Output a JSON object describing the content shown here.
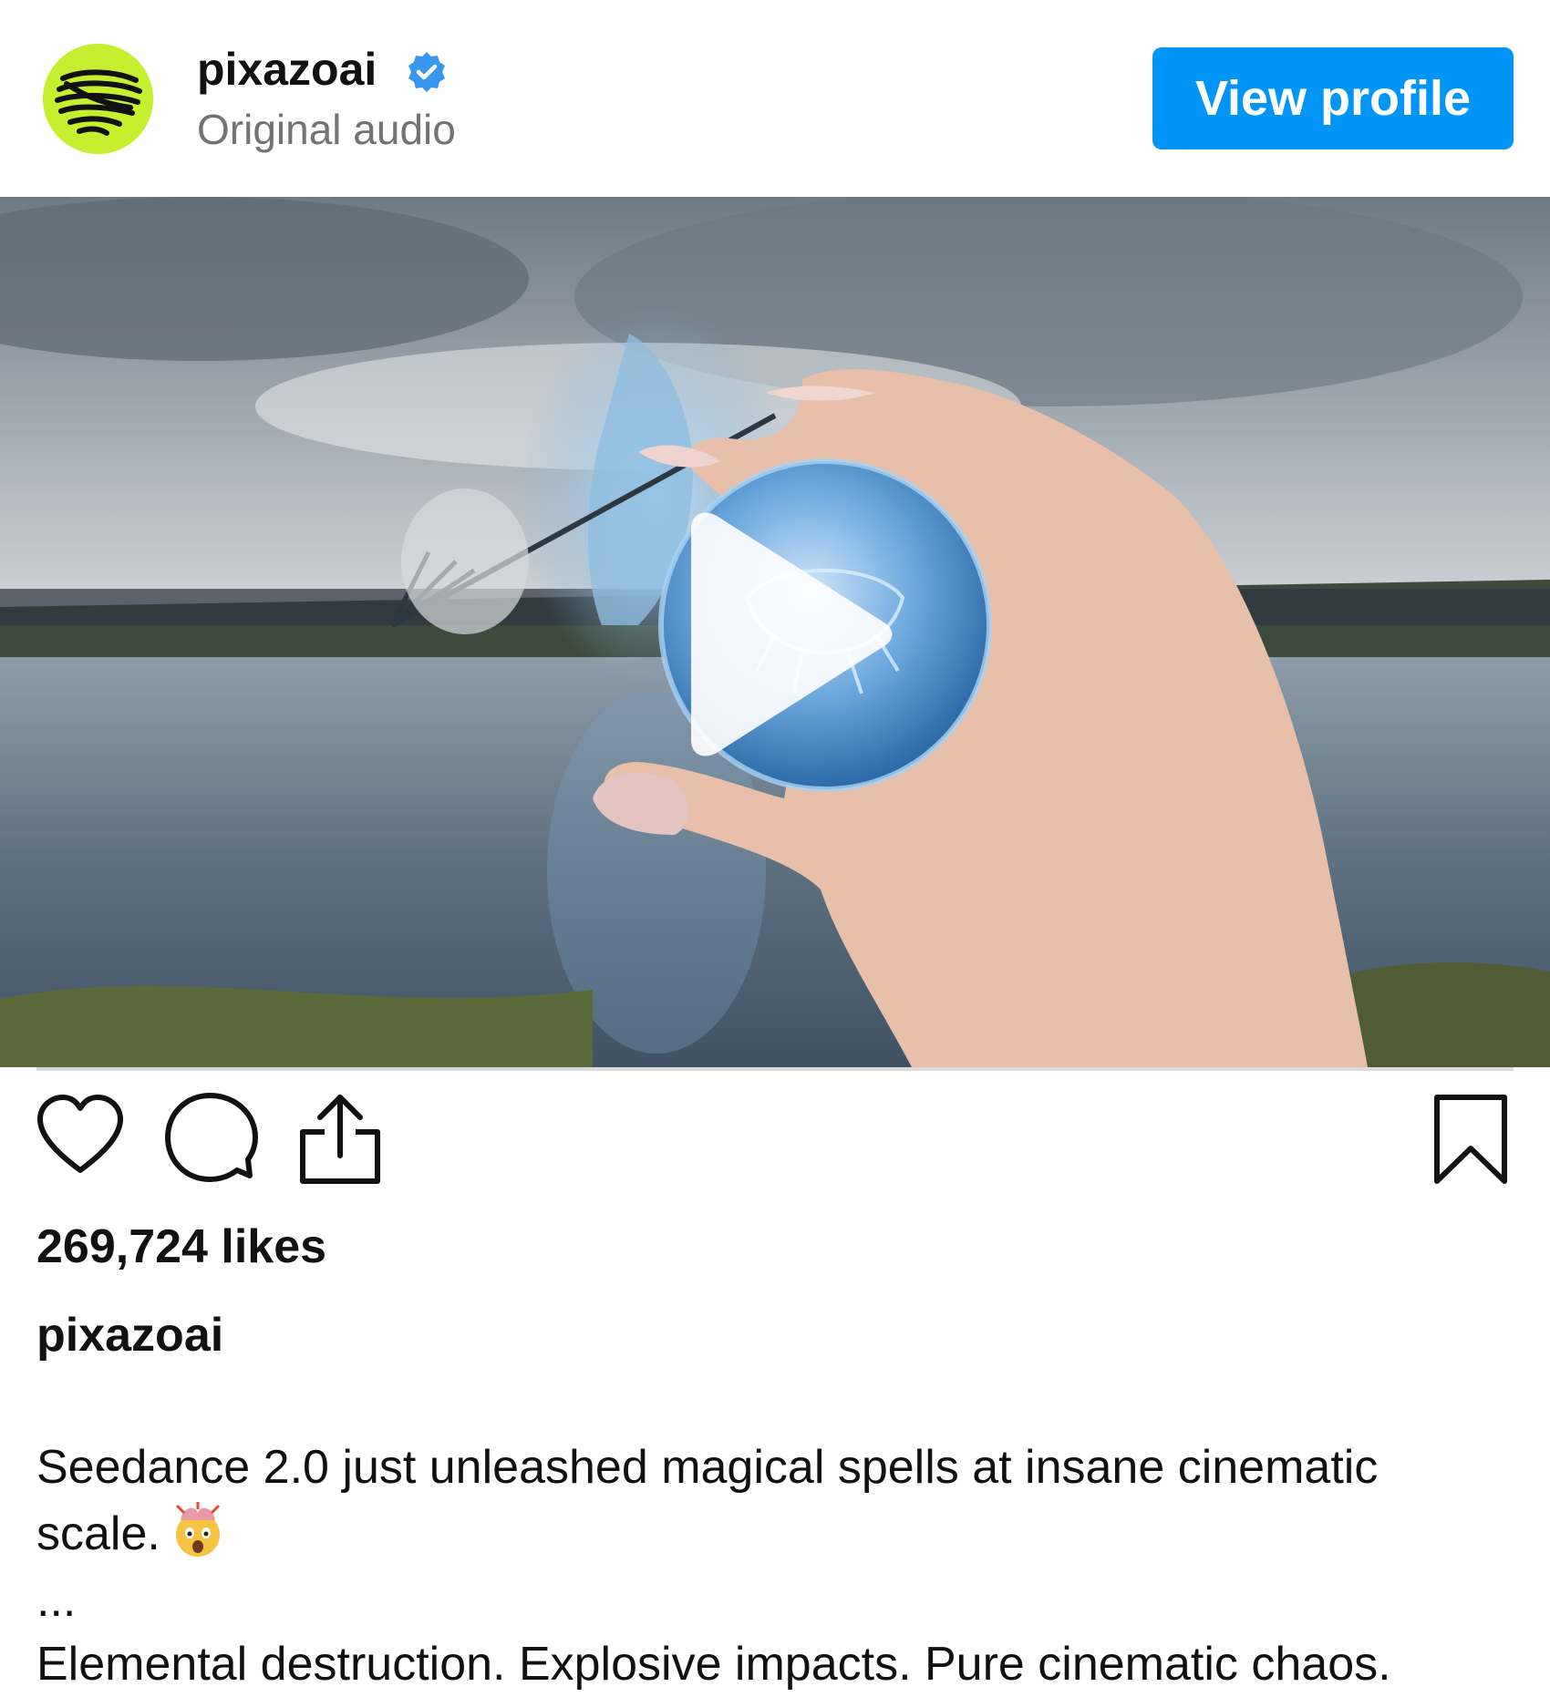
{
  "post": {
    "username": "pixazoai",
    "audio_label": "Original audio",
    "verified": true,
    "view_profile_label": "View profile",
    "accent_color": "#0095f6",
    "avatar_color": "#c6ef2e"
  },
  "media": {
    "type": "video",
    "play_icon": "play-icon"
  },
  "actions": {
    "like_icon": "heart-icon",
    "comment_icon": "comment-icon",
    "share_icon": "share-icon",
    "save_icon": "bookmark-icon"
  },
  "stats": {
    "likes_text": "269,724 likes"
  },
  "caption": {
    "username": "pixazoai",
    "line1": "Seedance 2.0 just unleashed magical spells at insane cinematic scale.",
    "emoji": "exploding-head-emoji",
    "ellipsis": "...",
    "line2": "Elemental destruction. Explosive impacts. Pure cinematic chaos."
  }
}
